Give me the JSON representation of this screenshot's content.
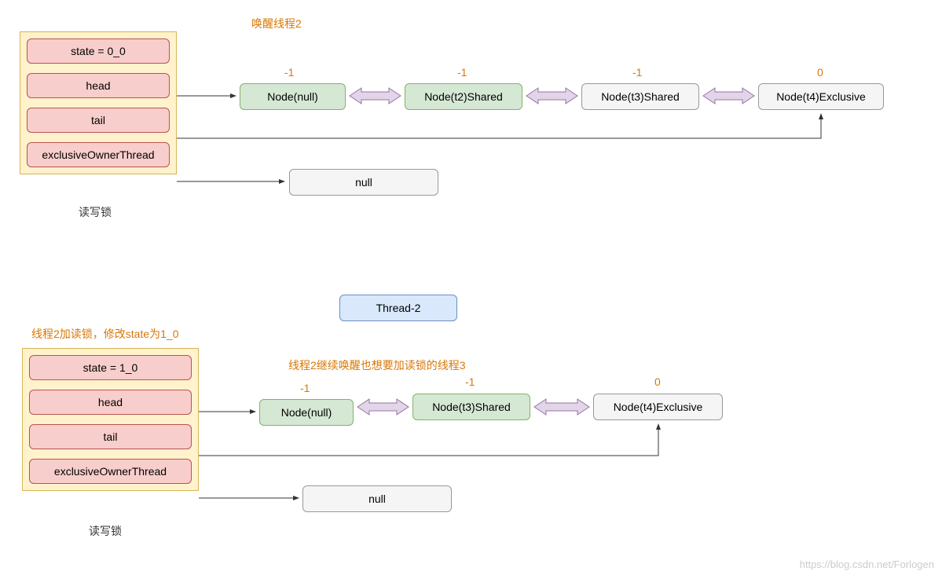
{
  "diagram1": {
    "title": "唤醒线程2",
    "lockCaption": "读写锁",
    "fields": {
      "state": "state = 0_0",
      "head": "head",
      "tail": "tail",
      "exclusiveOwnerThread": "exclusiveOwnerThread"
    },
    "nodes": {
      "headNode": {
        "text": "Node(null)",
        "label": "-1"
      },
      "t2": {
        "text": "Node(t2)Shared",
        "label": "-1"
      },
      "t3": {
        "text": "Node(t3)Shared",
        "label": "-1"
      },
      "t4": {
        "text": "Node(t4)Exclusive",
        "label": "0"
      }
    },
    "eotNode": "null"
  },
  "diagram2": {
    "title": "线程2加读锁，修改state为1_0",
    "subtitle": "线程2继续唤醒也想要加读锁的线程3",
    "thread": "Thread-2",
    "lockCaption": "读写锁",
    "fields": {
      "state": "state = 1_0",
      "head": "head",
      "tail": "tail",
      "exclusiveOwnerThread": "exclusiveOwnerThread"
    },
    "nodes": {
      "headNode": {
        "text": "Node(null)",
        "label": "-1"
      },
      "t3": {
        "text": "Node(t3)Shared",
        "label": "-1"
      },
      "t4": {
        "text": "Node(t4)Exclusive",
        "label": "0"
      }
    },
    "eotNode": "null"
  },
  "watermark": "https://blog.csdn.net/Forlogen"
}
